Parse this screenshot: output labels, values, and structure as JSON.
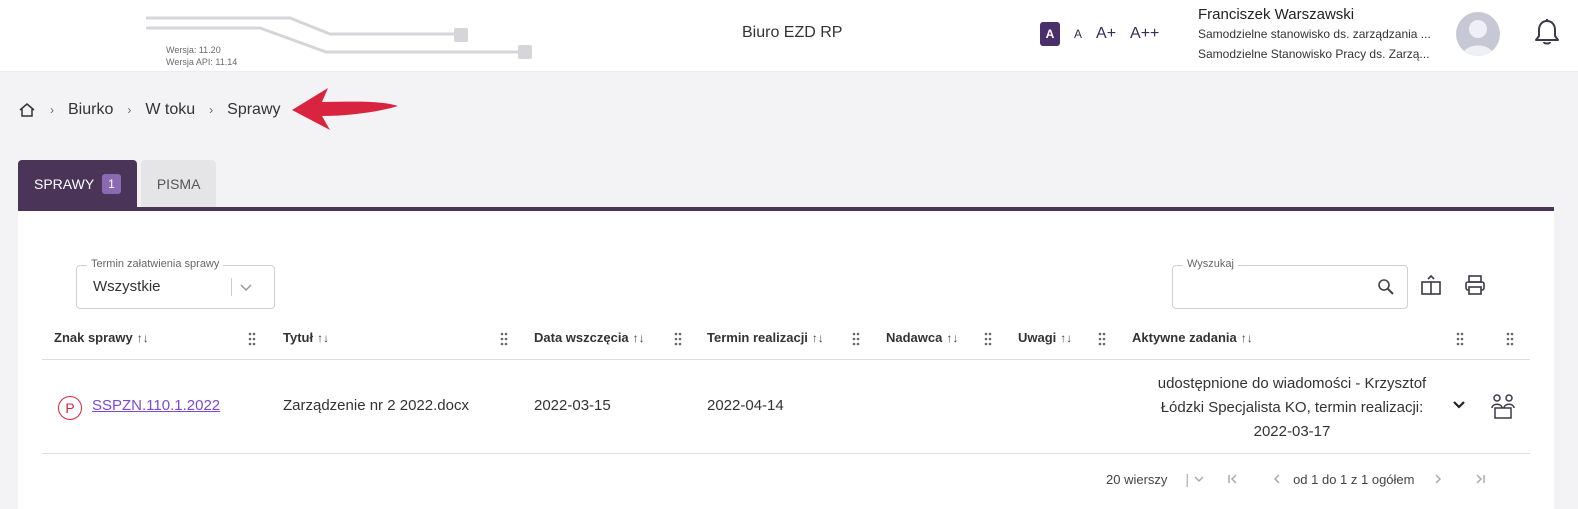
{
  "header": {
    "version": "Wersja: 11.20",
    "api_version": "Wersja API: 11.14",
    "app_title": "Biuro EZD RP",
    "font_sizes": [
      "A",
      "A",
      "A+",
      "A++"
    ],
    "user_name": "Franciszek Warszawski",
    "user_role_1": "Samodzielne stanowisko ds. zarządzania ...",
    "user_role_2": "Samodzielne Stanowisko Pracy ds. Zarzą..."
  },
  "breadcrumb": {
    "items": [
      "Biurko",
      "W toku",
      "Sprawy"
    ]
  },
  "tabs": [
    {
      "label": "SPRAWY",
      "badge": "1"
    },
    {
      "label": "PISMA"
    }
  ],
  "filter": {
    "label": "Termin załatwienia sprawy",
    "value": "Wszystkie"
  },
  "search": {
    "label": "Wyszukaj",
    "placeholder": ""
  },
  "table": {
    "columns": [
      "Znak sprawy",
      "Tytuł",
      "Data wszczęcia",
      "Termin realizacji",
      "Nadawca",
      "Uwagi",
      "Aktywne zadania"
    ],
    "sort_icon": "↑↓",
    "rows": [
      {
        "badge": "P",
        "case_id": "SSPZN.110.1.2022",
        "title": "Zarządzenie nr 2 2022.docx",
        "start_date": "2022-03-15",
        "due_date": "2022-04-14",
        "sender": "",
        "notes": "",
        "active_task_1": "udostępnione do wiadomości - Krzysztof",
        "active_task_2": "Łódzki Specjalista KO, termin realizacji:",
        "active_task_3": "2022-03-17"
      }
    ]
  },
  "pagination": {
    "rows_per_page": "20 wierszy",
    "summary": "od 1 do 1 z 1 ogółem"
  },
  "colors": {
    "primary": "#4a3559",
    "badge": "#8a6ab3",
    "link": "#7a4ad6",
    "accent_red": "#d8243f"
  }
}
